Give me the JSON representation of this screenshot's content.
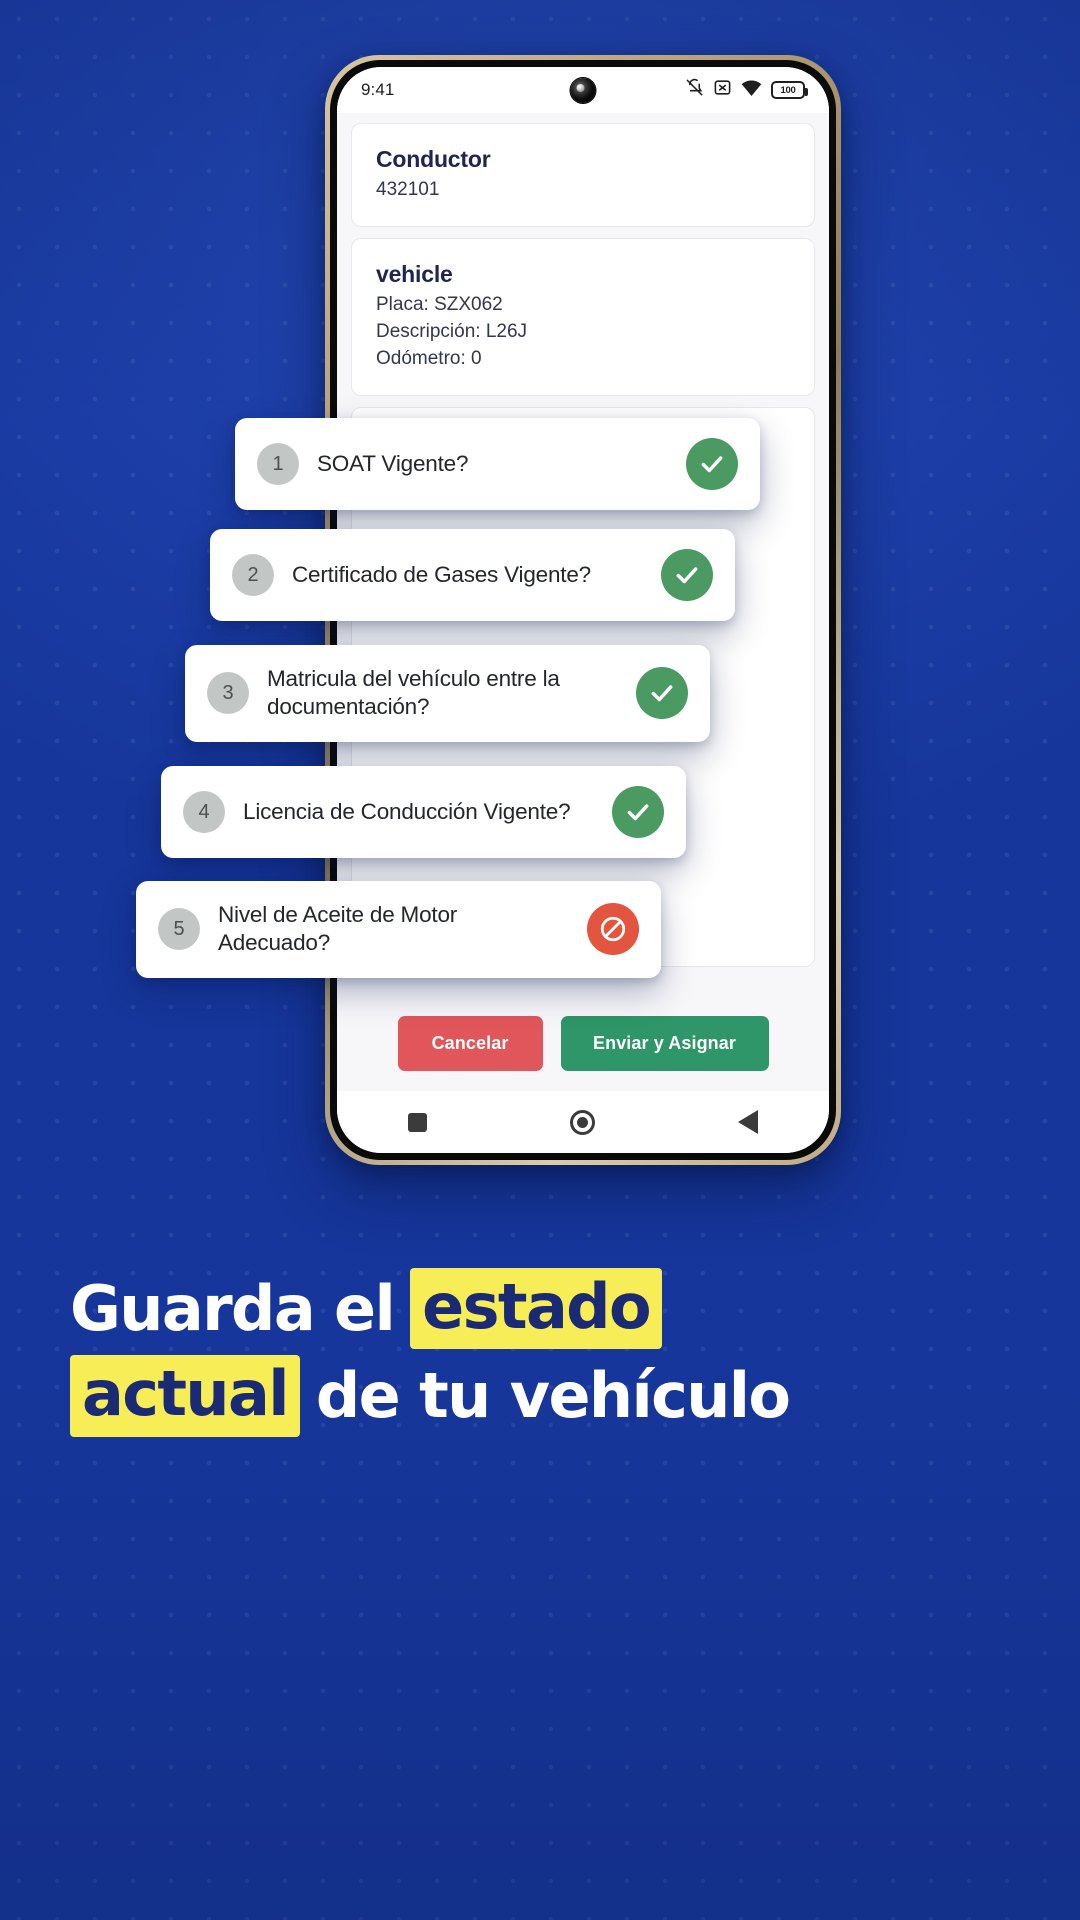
{
  "status_bar": {
    "time": "9:41",
    "battery_level": "100",
    "icons": [
      "notifications-muted-icon",
      "sim-off-icon",
      "wifi-icon",
      "battery-icon"
    ]
  },
  "driver_card": {
    "title": "Conductor",
    "id": "432101"
  },
  "vehicle_card": {
    "title": "vehicle",
    "plate": "Placa: SZX062",
    "description": "Descripción: L26J",
    "odometer": "Odómetro: 0"
  },
  "checklist": [
    {
      "number": "1",
      "question": "SOAT Vigente?",
      "status": "ok",
      "status_icon": "check-icon"
    },
    {
      "number": "2",
      "question": "Certificado de Gases Vigente?",
      "status": "ok",
      "status_icon": "check-icon"
    },
    {
      "number": "3",
      "question": "Matricula del vehículo entre la documentación?",
      "status": "ok",
      "status_icon": "check-icon"
    },
    {
      "number": "4",
      "question": "Licencia de Conducción Vigente?",
      "status": "ok",
      "status_icon": "check-icon"
    },
    {
      "number": "5",
      "question": "Nivel de Aceite de Motor Adecuado?",
      "status": "no",
      "status_icon": "prohibited-icon"
    }
  ],
  "actions": {
    "cancel_label": "Cancelar",
    "submit_label": "Enviar y Asignar"
  },
  "nav_bar": {
    "recents": "square-icon",
    "home": "circle-icon",
    "back": "triangle-back-icon"
  },
  "headline": {
    "line1_a": "Guarda el",
    "line1_b": "estado",
    "line2_a": "actual",
    "line2_b": "de tu vehículo"
  },
  "colors": {
    "background_blue": "#1d3fa8",
    "accent_yellow": "#f6ed57",
    "headline_text": "#ffffff",
    "highlight_text": "#1a2a74",
    "ok_green": "#4a9a62",
    "no_red": "#e4553f",
    "cancel_red": "#e0565b",
    "submit_green": "#2e9668",
    "card_title": "#1f2452"
  }
}
